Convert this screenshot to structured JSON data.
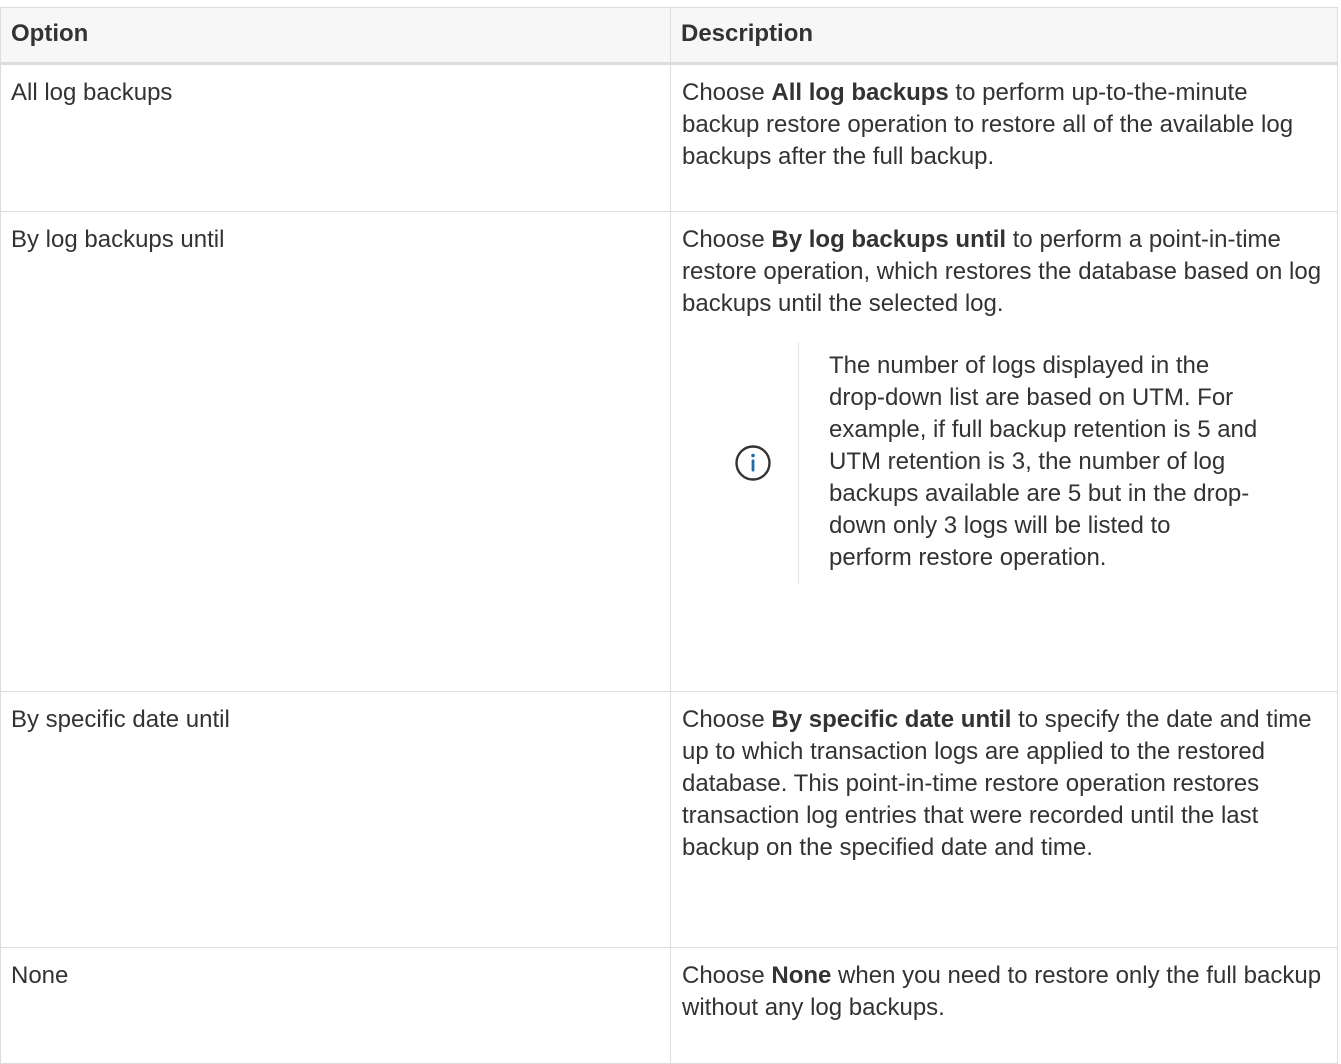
{
  "table": {
    "headers": {
      "option": "Option",
      "description": "Description"
    },
    "rows": [
      {
        "option": "All log backups",
        "desc_pre": "Choose ",
        "desc_bold": "All log backups",
        "desc_post": " to perform up-to-the-minute backup restore operation to restore all of the available log backups after the full backup."
      },
      {
        "option": "By log backups until",
        "desc_pre": "Choose ",
        "desc_bold": "By log backups until",
        "desc_post": " to perform a point-in-time restore operation, which restores the database based on log backups until the selected log.",
        "note": "The number of logs displayed in the drop-down list are based on UTM. For example, if full backup retention is 5 and UTM retention is 3, the number of log backups available are 5 but in the drop-down only 3 logs will be listed to perform restore operation."
      },
      {
        "option": "By specific date until",
        "desc_pre": "Choose ",
        "desc_bold": "By specific date until",
        "desc_post": " to specify the date and time up to which transaction logs are applied to the restored database. This point-in-time restore operation restores transaction log entries that were recorded until the last backup on the specified date and time."
      },
      {
        "option": "None",
        "desc_pre": "Choose ",
        "desc_bold": "None",
        "desc_post": " when you need to restore only the full backup without any log backups."
      }
    ]
  },
  "icons": {
    "note_icon": "info-icon",
    "note_icon_color": "#1a6ea8"
  }
}
